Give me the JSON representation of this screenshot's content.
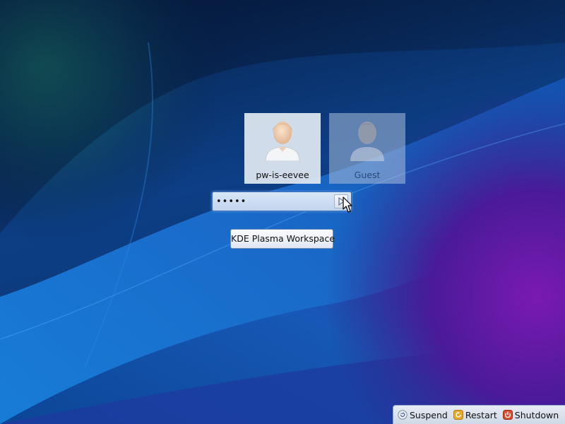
{
  "users": [
    {
      "name": "pw-is-eevee",
      "icon": "user-avatar-icon",
      "selected": true
    },
    {
      "name": "Guest",
      "icon": "user-avatar-icon",
      "selected": false
    }
  ],
  "login": {
    "password_value": "•••••",
    "submit_icon": "arrow-right-icon"
  },
  "session": {
    "label": "KDE Plasma Workspace"
  },
  "power": {
    "suspend": {
      "label": "Suspend",
      "icon": "suspend-icon",
      "color": "#e9eef6"
    },
    "restart": {
      "label": "Restart",
      "icon": "restart-icon",
      "color": "#e8a928"
    },
    "shutdown": {
      "label": "Shutdown",
      "icon": "shutdown-icon",
      "color": "#d94a2f"
    }
  },
  "colors": {
    "wallpaper_base": "#0a2a5c",
    "wallpaper_light": "#1d78d8",
    "wallpaper_purple": "#6a1aa0",
    "wallpaper_teal": "#1a6a6a"
  }
}
